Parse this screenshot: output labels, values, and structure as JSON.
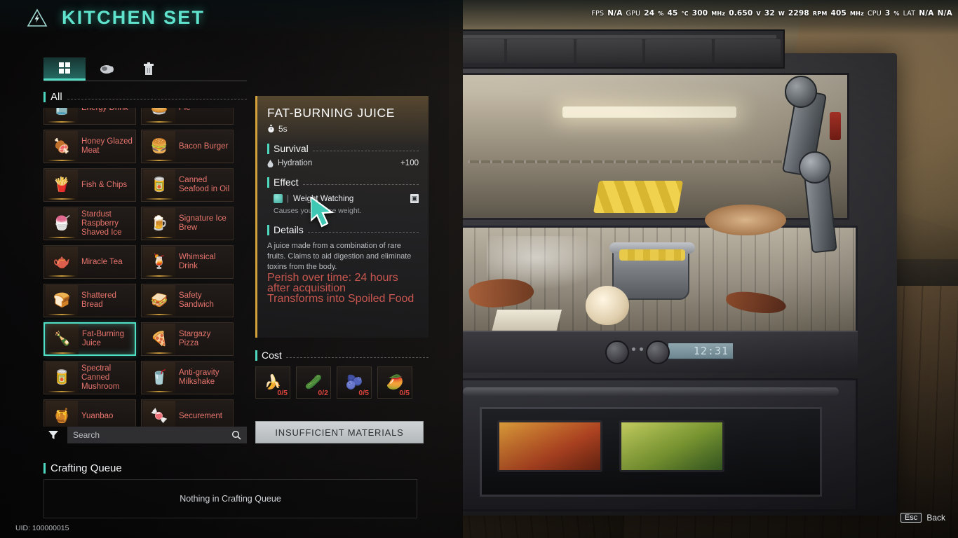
{
  "header": {
    "title": "KITCHEN SET",
    "logo_icon": "hazard-triangle-icon"
  },
  "perf_overlay": {
    "fps_label": "FPS",
    "fps_value": "N/A",
    "gpu_label": "GPU",
    "gpu_usage": "24",
    "gpu_usage_unit": "%",
    "gpu_temp": "45",
    "gpu_temp_unit": "°C",
    "gpu_clock": "300",
    "gpu_clock_unit": "MHz",
    "gpu_volt": "0.650",
    "gpu_volt_unit": "V",
    "gpu_power": "32",
    "gpu_power_unit": "W",
    "fan_rpm": "2298",
    "fan_rpm_unit": "RPM",
    "mem_clock": "405",
    "mem_clock_unit": "MHz",
    "cpu_label": "CPU",
    "cpu_usage": "3",
    "cpu_usage_unit": "%",
    "lat_label": "LAT",
    "lat_value_1": "N/A",
    "lat_value_2": "N/A"
  },
  "tabs": [
    {
      "name": "grid",
      "icon": "grid-icon",
      "active": true
    },
    {
      "name": "food",
      "icon": "meat-icon",
      "active": false
    },
    {
      "name": "discard",
      "icon": "trash-icon",
      "active": false
    }
  ],
  "catalog": {
    "filter_label": "All",
    "items": [
      {
        "name": "Energy Drink",
        "icon": "🫙",
        "selected": false,
        "partial": true
      },
      {
        "name": "Pie",
        "icon": "🥧",
        "selected": false,
        "partial": true
      },
      {
        "name": "Honey Glazed Meat",
        "icon": "🍖",
        "selected": false
      },
      {
        "name": "Bacon Burger",
        "icon": "🍔",
        "selected": false
      },
      {
        "name": "Fish & Chips",
        "icon": "🍟",
        "selected": false
      },
      {
        "name": "Canned Seafood in Oil",
        "icon": "🥫",
        "selected": false
      },
      {
        "name": "Stardust Raspberry Shaved Ice",
        "icon": "🍧",
        "selected": false
      },
      {
        "name": "Signature Ice Brew",
        "icon": "🍺",
        "selected": false
      },
      {
        "name": "Miracle Tea",
        "icon": "🫖",
        "selected": false
      },
      {
        "name": "Whimsical Drink",
        "icon": "🍹",
        "selected": false
      },
      {
        "name": "Shattered Bread",
        "icon": "🍞",
        "selected": false
      },
      {
        "name": "Safety Sandwich",
        "icon": "🥪",
        "selected": false
      },
      {
        "name": "Fat-Burning Juice",
        "icon": "🍾",
        "selected": true
      },
      {
        "name": "Stargazy Pizza",
        "icon": "🍕",
        "selected": false
      },
      {
        "name": "Spectral Canned Mushroom",
        "icon": "🥫",
        "selected": false
      },
      {
        "name": "Anti-gravity Milkshake",
        "icon": "🥤",
        "selected": false
      },
      {
        "name": "Yuanbao",
        "icon": "🍯",
        "selected": false
      },
      {
        "name": "Securement",
        "icon": "🍬",
        "selected": false
      }
    ]
  },
  "search": {
    "placeholder": "Search",
    "value": "",
    "filter_icon": "funnel-icon",
    "search_icon": "magnifier-icon"
  },
  "detail": {
    "title": "FAT-BURNING JUICE",
    "craft_time": "5s",
    "timer_icon": "stopwatch-icon",
    "survival_heading": "Survival",
    "survival_stats": [
      {
        "icon": "droplet-icon",
        "label": "Hydration",
        "value": "+100"
      }
    ],
    "effect_heading": "Effect",
    "effects": [
      {
        "icon": "buff-icon",
        "separator": "|",
        "label": "Weight Watching",
        "badge": "▣",
        "description": "Causes you to lose weight."
      }
    ],
    "details_heading": "Details",
    "description": "A juice made from a combination of rare fruits. Claims to aid digestion and eliminate toxins from the body.",
    "warnings": [
      "Perish over time: 24 hours after acquisition",
      "Transforms into Spoiled Food"
    ]
  },
  "cost": {
    "heading": "Cost",
    "materials": [
      {
        "name": "banana",
        "icon": "🍌",
        "qty": "0/5"
      },
      {
        "name": "cucumber",
        "icon": "🥒",
        "qty": "0/2"
      },
      {
        "name": "blueberries",
        "icon": "🫐",
        "qty": "0/5"
      },
      {
        "name": "mango",
        "icon": "🥭",
        "qty": "0/5"
      }
    ]
  },
  "craft_button": {
    "label": "INSUFFICIENT MATERIALS",
    "enabled": false
  },
  "queue": {
    "heading": "Crafting Queue",
    "empty_text": "Nothing in Crafting Queue"
  },
  "footer": {
    "uid": "UID: 100000015",
    "back_key": "Esc",
    "back_label": "Back"
  },
  "scene": {
    "oven_clock": "12:31"
  },
  "colors": {
    "accent_teal": "#4fd8c0",
    "title_teal": "#5fe3cd",
    "item_name_red": "#e8756d",
    "warning_red": "#c8574f",
    "cost_red": "#d8443c",
    "detail_gold": "#d4a03a"
  }
}
